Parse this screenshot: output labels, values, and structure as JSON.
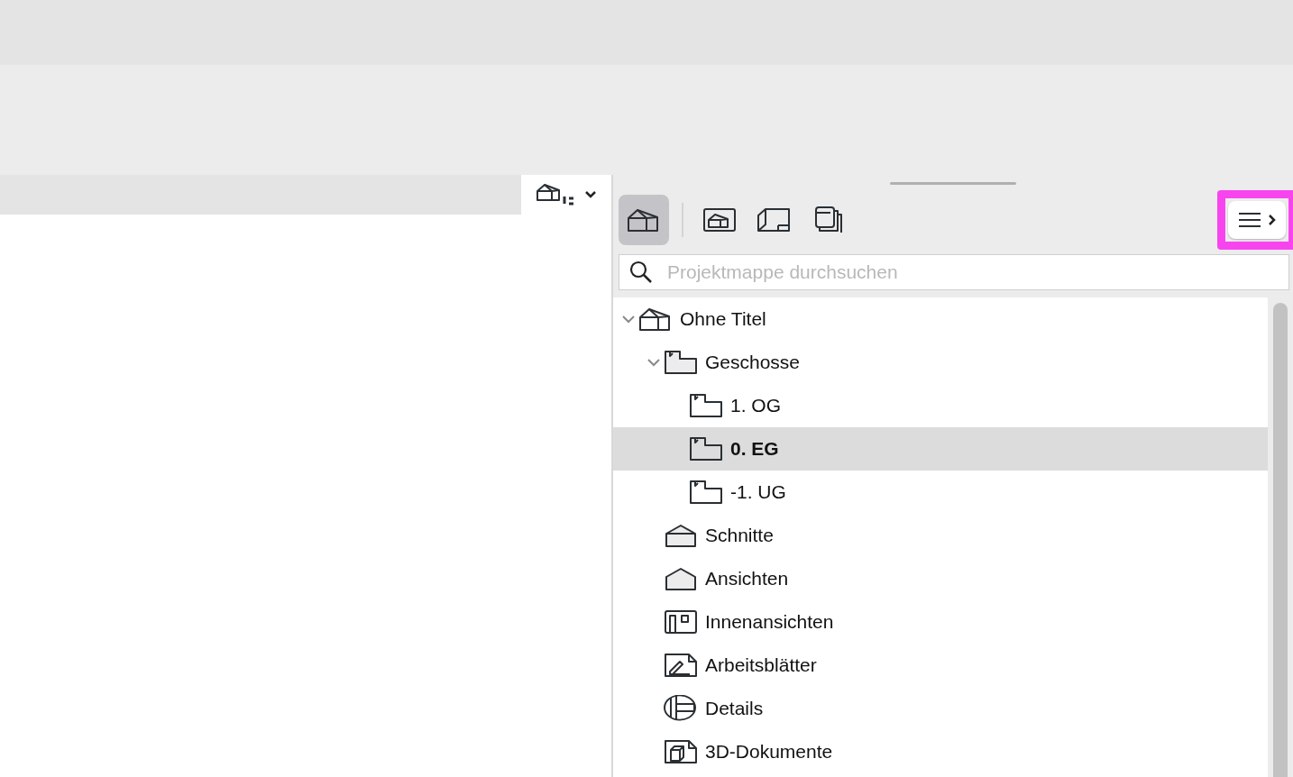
{
  "navigator": {
    "view_buttons": [
      {
        "kind": "project",
        "selected": true
      },
      {
        "kind": "layout",
        "selected": false
      },
      {
        "kind": "publisher",
        "selected": false
      },
      {
        "kind": "sets",
        "selected": false
      }
    ],
    "search": {
      "placeholder": "Projektmappe durchsuchen"
    },
    "tree": [
      {
        "label": "Ohne Titel",
        "kind": "project",
        "expanded": true,
        "selected": false,
        "children": [
          {
            "label": "Geschosse",
            "kind": "storeys",
            "expanded": true,
            "selected": false,
            "children": [
              {
                "label": "1. OG",
                "kind": "storey",
                "selected": false
              },
              {
                "label": "0. EG",
                "kind": "storey",
                "selected": true
              },
              {
                "label": "-1. UG",
                "kind": "storey",
                "selected": false
              }
            ]
          },
          {
            "label": "Schnitte",
            "kind": "section",
            "selected": false
          },
          {
            "label": "Ansichten",
            "kind": "elevation",
            "selected": false
          },
          {
            "label": "Innenansichten",
            "kind": "interior",
            "selected": false
          },
          {
            "label": "Arbeitsblätter",
            "kind": "worksheet",
            "selected": false
          },
          {
            "label": "Details",
            "kind": "detail",
            "selected": false
          },
          {
            "label": "3D-Dokumente",
            "kind": "document3d",
            "selected": false
          }
        ]
      }
    ]
  }
}
